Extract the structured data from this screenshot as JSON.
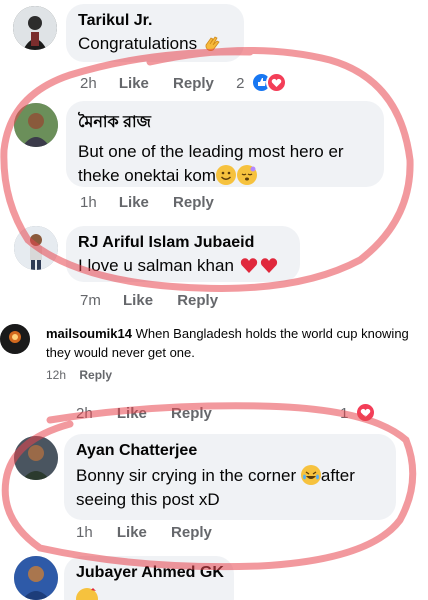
{
  "comments": [
    {
      "author": "Tarikul Jr.",
      "text": "Congratulations",
      "time": "2h",
      "like": "Like",
      "reply": "Reply",
      "reaction_count": "2"
    },
    {
      "author": "মৈনাক রাজ",
      "text_line1": "But one of the leading most hero er",
      "text_line2": "theke onektai kom",
      "time": "1h",
      "like": "Like",
      "reply": "Reply"
    },
    {
      "author": "RJ Ariful Islam Jubaeid",
      "text": "I love u salman khan",
      "time": "7m",
      "like": "Like",
      "reply": "Reply"
    },
    {
      "author": "Ayan Chatterjee",
      "text_line1": "Bonny sir crying in the corner",
      "text_after_emoji": "after",
      "text_line2": "seeing this post xD",
      "time": "1h",
      "like": "Like",
      "reply": "Reply"
    },
    {
      "author": "Jubayer Ahmed GK"
    }
  ],
  "embedded": {
    "author": "mailsoumik14",
    "text_line1": " When Bangladesh holds the world cup knowing",
    "text_line2": "they would never get one.",
    "time": "12h",
    "reply": "Reply"
  },
  "overlay_row": {
    "time": "2h",
    "like": "Like",
    "reply": "Reply",
    "reaction_count": "1"
  },
  "colors": {
    "bubble": "#f0f2f5",
    "meta": "#65676b",
    "marker": "#e8454f",
    "like_blue": "#1877f2",
    "love_red": "#f33e58"
  },
  "icons": [
    "thumbs-up-icon",
    "heart-icon",
    "clapping-hands-icon",
    "smiling-face-icon",
    "starstruck-face-icon",
    "rofl-face-icon"
  ]
}
